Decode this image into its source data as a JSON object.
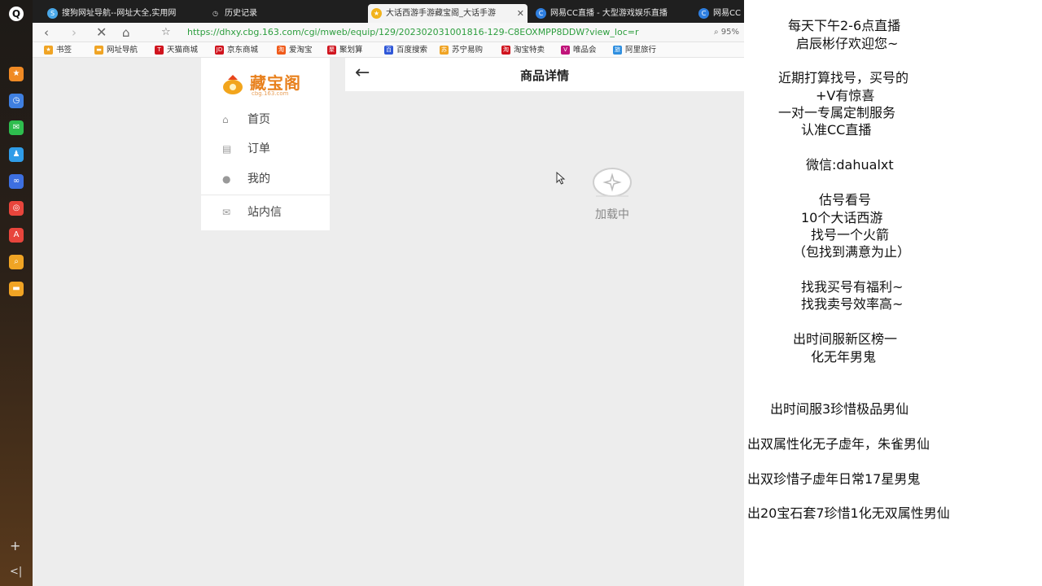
{
  "tabs": [
    {
      "title": "搜狗网址导航--网址大全,实用网",
      "active": false
    },
    {
      "title": "历史记录",
      "active": false
    },
    {
      "title": "大话西游手游藏宝阁_大话手游",
      "active": true
    },
    {
      "title": "网易CC直播 - 大型游戏娱乐直播",
      "active": false
    },
    {
      "title": "网易CC",
      "active": false
    }
  ],
  "address": {
    "url": "https://dhxy.cbg.163.com/cgi/mweb/equip/129/202302031001816-129-C8EOXMPP8DDW?view_loc=r",
    "zoom": "95%"
  },
  "bookmarks": [
    "书签",
    "网址导航",
    "天猫商城",
    "京东商城",
    "爱淘宝",
    "聚划算",
    "百度搜索",
    "苏宁易购",
    "淘宝特卖",
    "唯品会",
    "阿里旅行"
  ],
  "site": {
    "brand": "藏宝阁",
    "brand_sub": "cbg.163.com",
    "nav": [
      "首页",
      "订单",
      "我的",
      "站内信"
    ],
    "page_title": "商品详情",
    "loading_text": "加载中"
  },
  "panel_lines": [
    "每天下午2-6点直播",
    "启辰彬仔欢迎您~",
    "近期打算找号，买号的",
    "+V有惊喜",
    "一对一专属定制服务",
    "认准CC直播",
    "微信:dahualxt",
    "估号看号",
    "10个大话西游",
    "找号一个火箭",
    "（包找到满意为止）",
    "找我买号有福利~",
    "找我卖号效率高~",
    "出时间服新区榜一",
    "化无年男鬼",
    "出时间服3珍惜极品男仙",
    "出双属性化无子虚年，朱雀男仙",
    "出双珍惜子虚年日常17星男鬼",
    "出20宝石套7珍惜1化无双属性男仙"
  ],
  "colors": {
    "accent": "#e8801c",
    "url_green": "#2d9e3e"
  }
}
